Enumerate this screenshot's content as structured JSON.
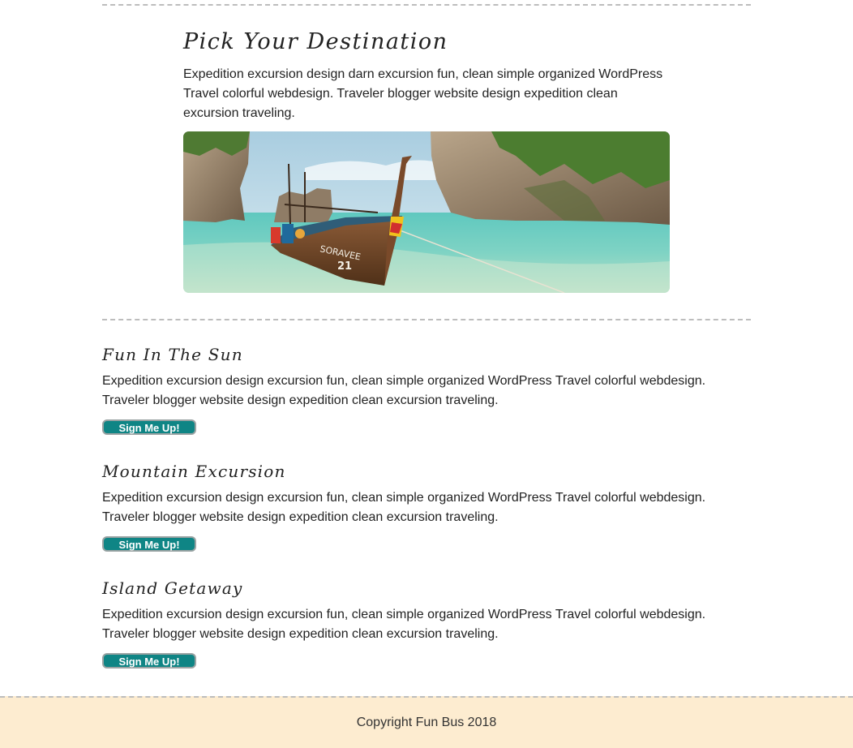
{
  "hero": {
    "title": "Pick Your Destination",
    "text": "Expedition excursion design darn excursion fun, clean simple organized WordPress Travel colorful webdesign. Traveler blogger website design expedition clean excursion traveling."
  },
  "trips": [
    {
      "title": "Fun In The Sun",
      "text": "Expedition excursion design excursion fun, clean simple organized WordPress Travel colorful webdesign. Traveler blogger website design expedition clean excursion traveling.",
      "button": "Sign Me Up!"
    },
    {
      "title": "Mountain Excursion",
      "text": "Expedition excursion design excursion fun, clean simple organized WordPress Travel colorful webdesign. Traveler blogger website design expedition clean excursion traveling.",
      "button": "Sign Me Up!"
    },
    {
      "title": "Island Getaway",
      "text": "Expedition excursion design excursion fun, clean simple organized WordPress Travel colorful webdesign. Traveler blogger website design expedition clean excursion traveling.",
      "button": "Sign Me Up!"
    }
  ],
  "footer": {
    "copyright": "Copyright Fun Bus 2018"
  },
  "colors": {
    "button_bg": "#0f8585",
    "footer_bg": "#fdecd0",
    "divider": "#bdbdbd"
  }
}
